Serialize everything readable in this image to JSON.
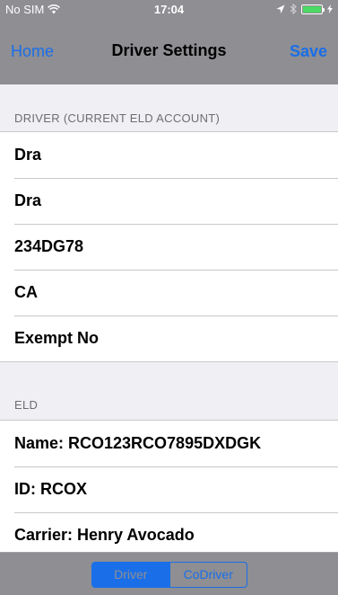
{
  "status_bar": {
    "carrier": "No SIM",
    "time": "17:04"
  },
  "nav": {
    "back_label": "Home",
    "title": "Driver Settings",
    "save_label": "Save"
  },
  "driver_section": {
    "header": "DRIVER (CURRENT ELD ACCOUNT)",
    "rows": [
      "Dra",
      "Dra",
      "234DG78",
      "CA",
      "Exempt No"
    ]
  },
  "eld_section": {
    "header": "ELD",
    "rows": [
      "Name: RCO123RCO7895DXDGK",
      "ID: RCOX",
      "Carrier: Henry Avocado"
    ]
  },
  "toolbar": {
    "segments": [
      "Driver",
      "CoDriver"
    ],
    "selected": "Driver"
  },
  "colors": {
    "accent": "#1a6fe8",
    "bar_gray": "#8e8e93",
    "battery_green": "#4cd964"
  },
  "icons": {
    "wifi": "wifi-icon",
    "location": "location-arrow-icon",
    "bluetooth": "bluetooth-icon",
    "battery": "battery-icon",
    "charging": "charging-bolt-icon"
  }
}
